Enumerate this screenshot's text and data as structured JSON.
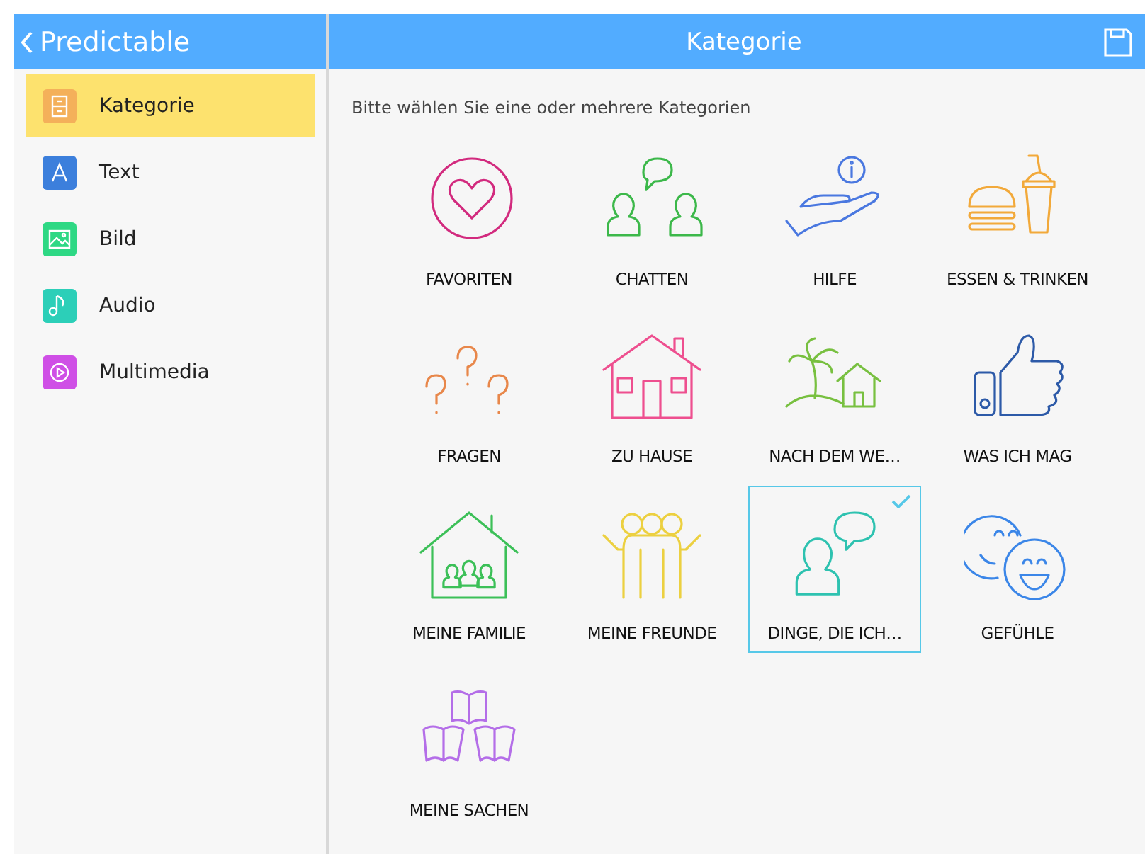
{
  "sidebar": {
    "back_label": "Predictable",
    "items": [
      {
        "label": "Kategorie",
        "kind": "category",
        "selected": true
      },
      {
        "label": "Text",
        "kind": "text",
        "selected": false
      },
      {
        "label": "Bild",
        "kind": "image",
        "selected": false
      },
      {
        "label": "Audio",
        "kind": "audio",
        "selected": false
      },
      {
        "label": "Multimedia",
        "kind": "media",
        "selected": false
      }
    ]
  },
  "header": {
    "title": "Kategorie"
  },
  "instruction": "Bitte wählen Sie eine oder mehrere Kategorien",
  "categories": [
    {
      "label": "FAVORITEN",
      "kind": "heart",
      "selected": false
    },
    {
      "label": "CHATTEN",
      "kind": "chat",
      "selected": false
    },
    {
      "label": "HILFE",
      "kind": "help",
      "selected": false
    },
    {
      "label": "ESSEN & TRINKEN",
      "kind": "food",
      "selected": false
    },
    {
      "label": "FRAGEN",
      "kind": "questions",
      "selected": false
    },
    {
      "label": "ZU HAUSE",
      "kind": "house",
      "selected": false
    },
    {
      "label": "NACH DEM WE…",
      "kind": "island",
      "selected": false
    },
    {
      "label": "WAS ICH MAG",
      "kind": "thumb",
      "selected": false
    },
    {
      "label": "MEINE FAMILIE",
      "kind": "family",
      "selected": false
    },
    {
      "label": "MEINE FREUNDE",
      "kind": "friends",
      "selected": false
    },
    {
      "label": "DINGE, DIE ICH…",
      "kind": "speaker",
      "selected": true
    },
    {
      "label": "GEFÜHLE",
      "kind": "faces",
      "selected": false
    },
    {
      "label": "MEINE SACHEN",
      "kind": "books",
      "selected": false
    }
  ]
}
